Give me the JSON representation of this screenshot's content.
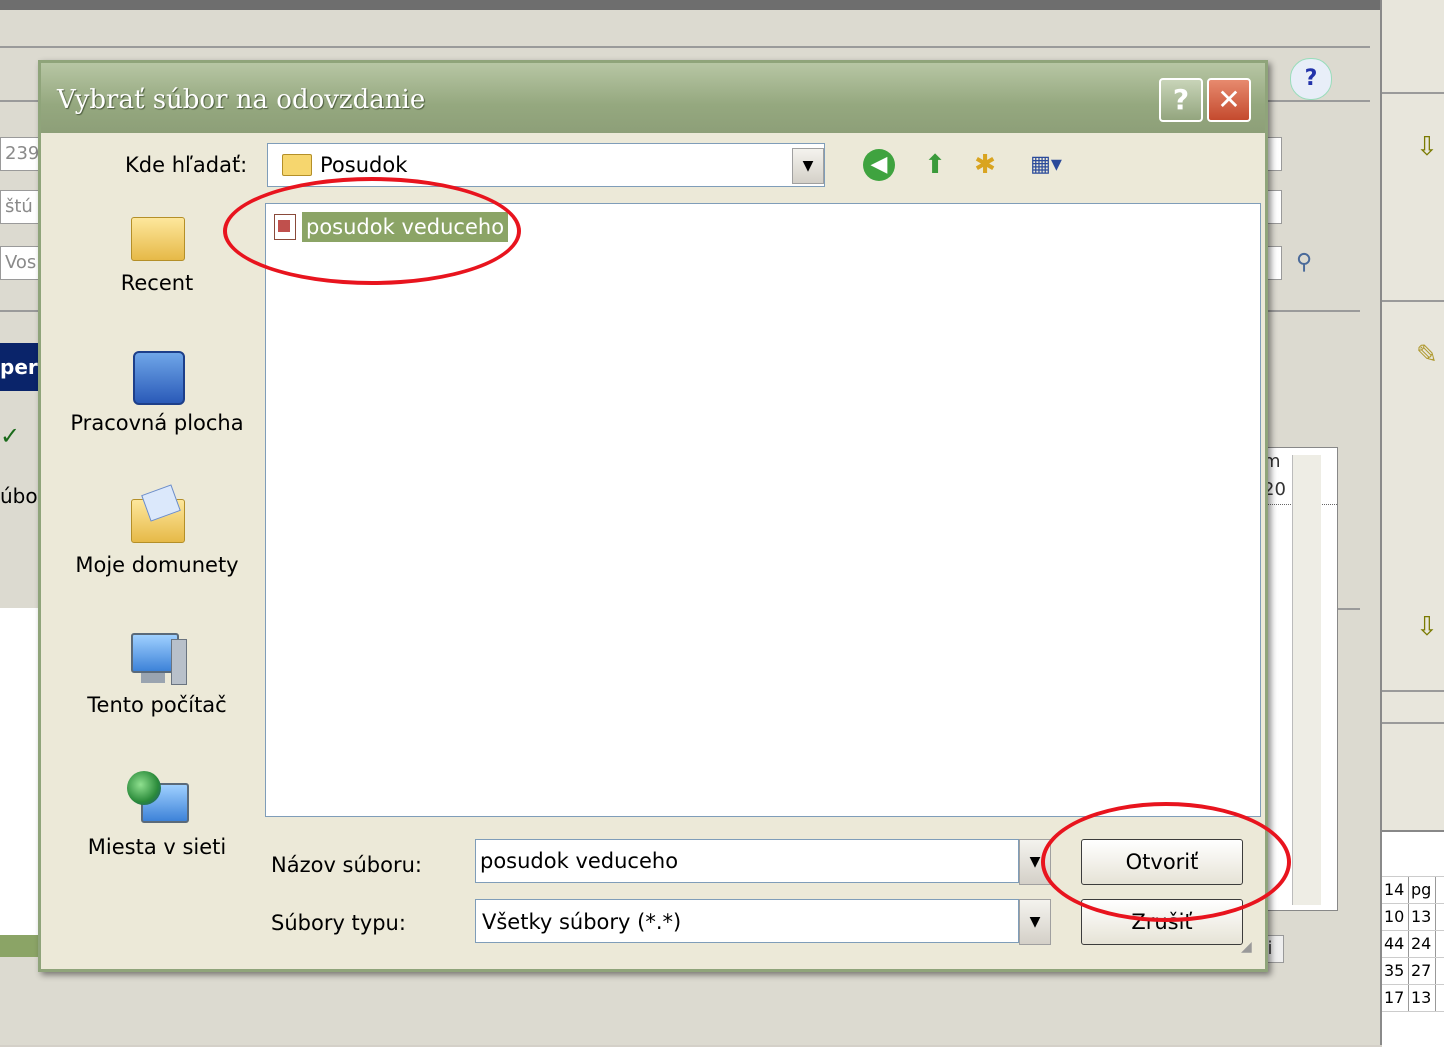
{
  "background": {
    "help_icon": "?",
    "fields": [
      "239",
      "štú",
      "Vos"
    ],
    "blue_label": "per",
    "side_label": "úbo",
    "grid_header": "m",
    "grid_row": "20",
    "table_rows": [
      [
        "14",
        "pg"
      ],
      [
        "10",
        "13"
      ],
      [
        "44",
        "24"
      ],
      [
        "35",
        "27"
      ],
      [
        "17",
        "13"
      ]
    ],
    "toolbar_icons": [
      "grid-icon",
      "sort-icon",
      "move-first-icon",
      "move-down-icon",
      "move-up-icon",
      "move-last-icon",
      "info-icon"
    ]
  },
  "dialog": {
    "title": "Vybrať súbor na odovzdanie",
    "help_button": "?",
    "close_button": "✕",
    "lookin_label": "Kde hľadať:",
    "lookin_value": "Posudok",
    "places": [
      {
        "label": "Recent",
        "icon": "recent-folder-icon"
      },
      {
        "label": "Pracovná plocha",
        "icon": "desktop-icon"
      },
      {
        "label": "Moje domunety",
        "icon": "my-documents-icon"
      },
      {
        "label": "Tento počítač",
        "icon": "my-computer-icon"
      },
      {
        "label": "Miesta v sieti",
        "icon": "network-places-icon"
      }
    ],
    "files": [
      {
        "name": "posudok veduceho",
        "icon": "pdf-file-icon",
        "selected": true
      }
    ],
    "filename_label": "Názov súboru:",
    "filename_value": "posudok veduceho",
    "filetype_label": "Súbory typu:",
    "filetype_value": "Všetky súbory (*.*)",
    "open_button": "Otvoriť",
    "cancel_button": "Zrušiť"
  },
  "annotations": {
    "color": "#e8141e"
  }
}
